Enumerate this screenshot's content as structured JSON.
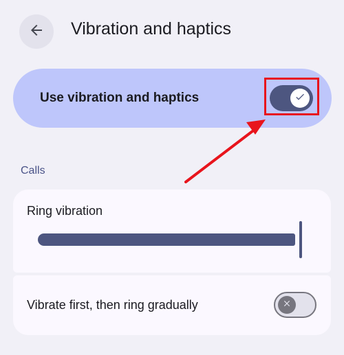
{
  "header": {
    "title": "Vibration and haptics",
    "back_icon": "arrow-back-icon"
  },
  "master_toggle": {
    "label": "Use vibration and haptics",
    "state": "on",
    "thumb_icon": "check-icon"
  },
  "calls_section": {
    "header": "Calls",
    "ring_vibration": {
      "label": "Ring vibration",
      "value": 1.0
    },
    "vibrate_first": {
      "label": "Vibrate first, then ring gradually",
      "state": "off",
      "thumb_icon": "close-icon"
    }
  },
  "annotation": {
    "color": "#e8141c"
  },
  "colors": {
    "background": "#f1f0f7",
    "master_row": "#bec6fb",
    "accent": "#4d5680",
    "card": "#fbf8ff",
    "section_header": "#4a5388"
  }
}
